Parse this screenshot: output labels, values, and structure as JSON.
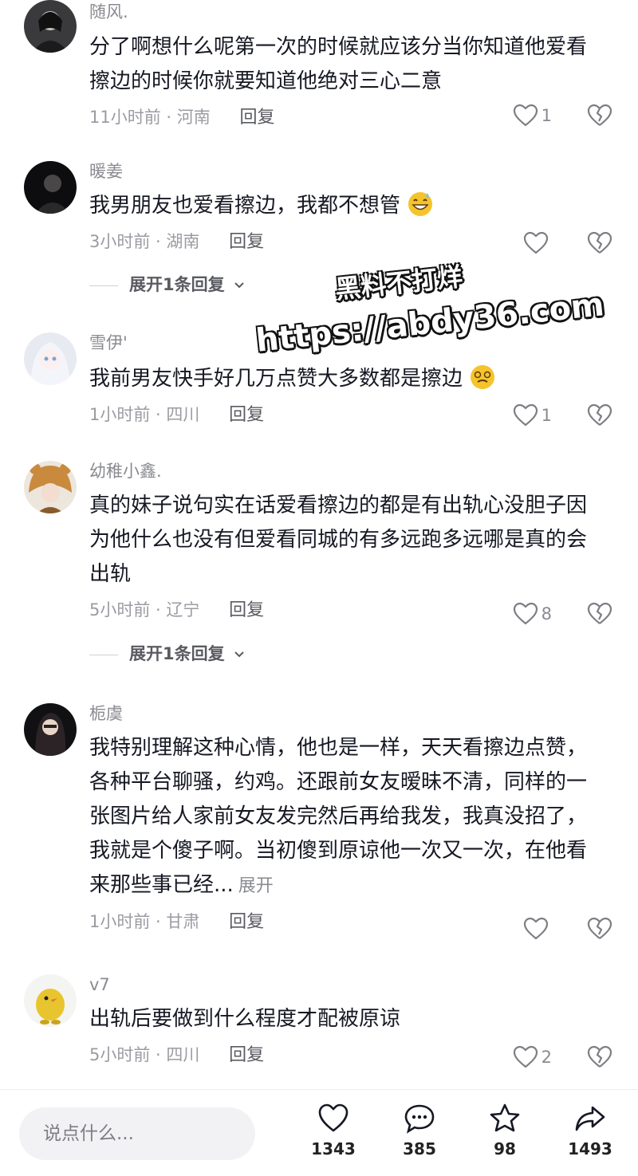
{
  "comments": [
    {
      "username": "随风.",
      "text": "分了啊想什么呢第一次的时候就应该分当你知道他爱看擦边的时候你就要知道他绝对三心二意",
      "time": "11小时前 · 河南",
      "reply": "回复",
      "likes": "1"
    },
    {
      "username": "暖姜",
      "text": "我男朋友也爱看擦边，我都不想管",
      "time": "3小时前 · 湖南",
      "reply": "回复",
      "likes": "",
      "expand": "展开1条回复"
    },
    {
      "username": "雪伊'",
      "text": "我前男友快手好几万点赞大多数都是擦边",
      "time": "1小时前 · 四川",
      "reply": "回复",
      "likes": "1"
    },
    {
      "username": "幼稚小鑫.",
      "text": "真的妹子说句实在话爱看擦边的都是有出轨心没胆子因为他什么也没有但爱看同城的有多远跑多远哪是真的会出轨",
      "time": "5小时前 · 辽宁",
      "reply": "回复",
      "likes": "8",
      "expand": "展开1条回复"
    },
    {
      "username": "栀虞",
      "text": "我特别理解这种心情，他也是一样，天天看擦边点赞，各种平台聊骚，约鸡。还跟前女友暧昧不清，同样的一张图片给人家前女友发完然后再给我发，我真没招了，我就是个傻子啊。当初傻到原谅他一次又一次，在他看来那些事已经...",
      "more": "展开",
      "time": "1小时前 · 甘肃",
      "reply": "回复",
      "likes": ""
    },
    {
      "username": "v7",
      "text": "出轨后要做到什么程度才配被原谅",
      "time": "5小时前 · 四川",
      "reply": "回复",
      "likes": "2"
    }
  ],
  "watermark": {
    "line1": "黑料不打烊",
    "line2": "https://abdy36.com"
  },
  "bottom_bar": {
    "input_placeholder": "说点什么...",
    "like_count": "1343",
    "comment_count": "385",
    "favorite_count": "98",
    "share_count": "1493"
  },
  "colors": {
    "accent": "#161823",
    "muted": "#8a8b91",
    "emoji": "#f5c32c"
  }
}
